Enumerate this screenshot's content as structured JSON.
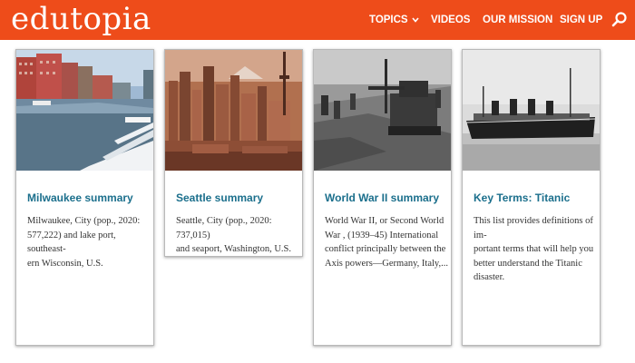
{
  "header": {
    "logo": "edutopia",
    "nav": [
      "TOPICS",
      "VIDEOS",
      "OUR MISSION",
      "SIGN UP"
    ],
    "brand_color": "#ee4c1a"
  },
  "cards": [
    {
      "title": "Milwaukee summary",
      "text": "Milwaukee, City (pop., 2020:\n577,222) and lake port, southeast-\nern Wisconsin, U.S.",
      "image": "milwaukee-harbor-photo"
    },
    {
      "title": "Seattle summary",
      "text": "Seattle, City (pop., 2020: 737,015)\nand seaport, Washington, U.S.",
      "image": "seattle-skyline-photo"
    },
    {
      "title": "World War II summary",
      "text": "World War II, or Second World\nWar , (1939–45) International\nconflict principally between the\nAxis powers—Germany, Italy,...",
      "image": "ww2-tank-photo"
    },
    {
      "title": "Key Terms: Titanic",
      "text": "This list provides definitions of im-\nportant terms that will help you\nbetter understand the Titanic\ndisaster.",
      "image": "titanic-ship-photo"
    }
  ],
  "accent_color": "#1b6f8c"
}
